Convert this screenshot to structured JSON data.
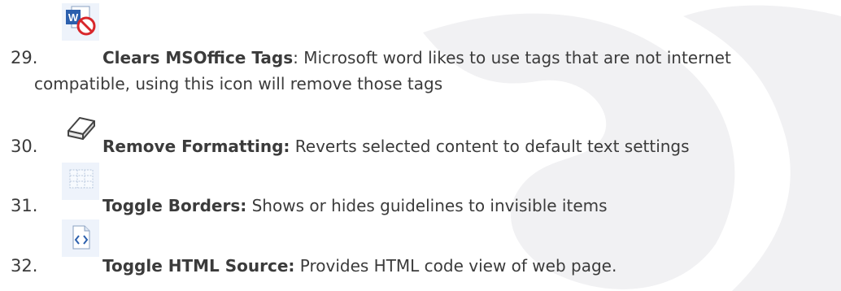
{
  "items": [
    {
      "number": "29.",
      "icon": "word-clear-tags-icon",
      "title": "Clears MSOffice Tags",
      "sep": ":",
      "desc_line1": " Microsoft word likes to use tags that are not internet",
      "desc_line2": "compatible, using this icon will remove those tags"
    },
    {
      "number": "30.",
      "icon": "eraser-icon",
      "title": "Remove Formatting:",
      "desc": " Reverts selected content to default text settings"
    },
    {
      "number": "31.",
      "icon": "table-borders-icon",
      "title": "Toggle Borders:",
      "desc": " Shows or hides guidelines to invisible items"
    },
    {
      "number": "32.",
      "icon": "html-source-icon",
      "title": "Toggle HTML Source:",
      "desc": " Provides HTML code view of web page."
    }
  ],
  "colors": {
    "text": "#3b3b3b",
    "watermark": "#f1f1f3"
  }
}
